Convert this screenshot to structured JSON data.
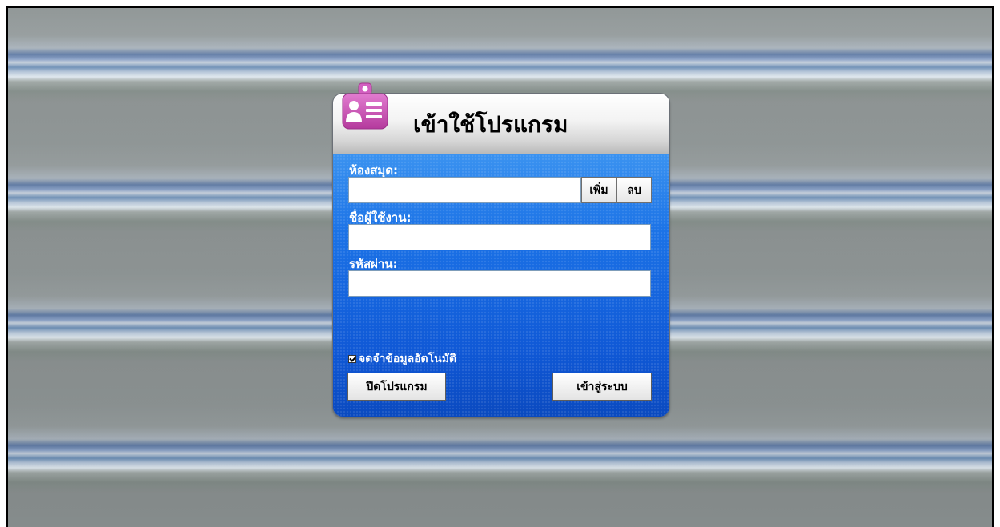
{
  "login": {
    "title": "เข้าใช้โปรแกรม",
    "library_label": "ห้องสมุด:",
    "library_value": "",
    "add_label": "เพิ่ม",
    "delete_label": "ลบ",
    "username_label": "ชื่อผู้ใช้งาน:",
    "username_value": "",
    "password_label": "รหัสผ่าน:",
    "password_value": "",
    "remember_label": "จดจำข้อมูลอัตโนมัติ",
    "remember_checked": true,
    "close_label": "ปิดโปรแกรม",
    "login_label": "เข้าสู่ระบบ"
  },
  "icons": {
    "header_icon": "id-badge-icon",
    "badge_color": "#c94bb2"
  },
  "colors": {
    "panel_blue": "#1565e0",
    "header_gray": "#d5d5d5"
  }
}
